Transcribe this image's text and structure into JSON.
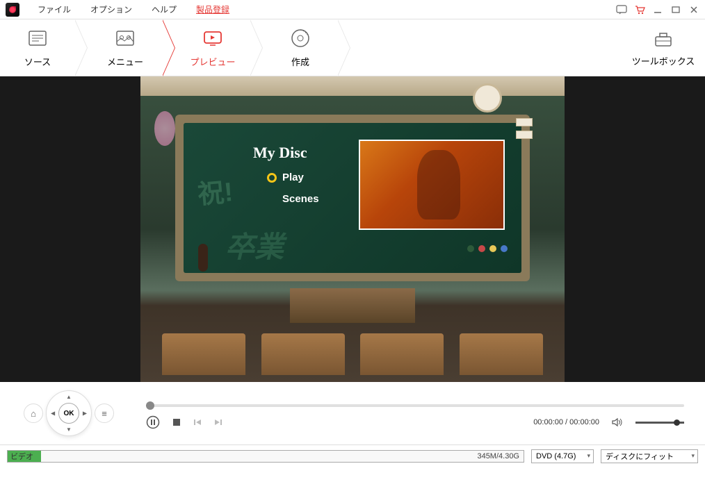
{
  "menubar": {
    "file": "ファイル",
    "options": "オプション",
    "help": "ヘルプ",
    "register": "製品登録"
  },
  "tabs": {
    "source": "ソース",
    "menu": "メニュー",
    "preview": "プレビュー",
    "create": "作成",
    "toolbox": "ツールボックス"
  },
  "disc_menu": {
    "title": "My Disc",
    "play": "Play",
    "scenes": "Scenes"
  },
  "nav": {
    "ok": "OK"
  },
  "playback": {
    "time": "00:00:00 / 00:00:00"
  },
  "bottom": {
    "video_label": "ビデオ",
    "size": "345M/4.30G",
    "disc_type": "DVD (4.7G)",
    "fit": "ディスクにフィット"
  }
}
